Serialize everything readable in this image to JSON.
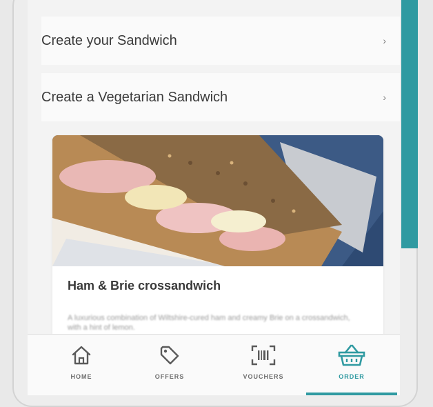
{
  "menu": {
    "items": [
      {
        "label": "Create your Sandwich",
        "chevron": "›"
      },
      {
        "label": "Create a Vegetarian Sandwich",
        "chevron": "›"
      }
    ]
  },
  "product": {
    "title": "Ham & Brie crossandwich",
    "description": "A luxurious combination of Wiltshire-cured ham and creamy Brie on a crossandwich, with a hint of lemon."
  },
  "nav": {
    "home": "HOME",
    "offers": "OFFERS",
    "vouchers": "VOUCHERS",
    "order": "ORDER",
    "active": "order"
  },
  "colors": {
    "accent": "#2f9aa1",
    "icon": "#5a5a5a"
  }
}
